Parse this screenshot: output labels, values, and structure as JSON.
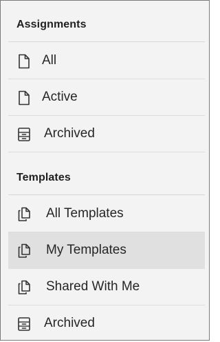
{
  "sections": [
    {
      "title": "Assignments",
      "items": [
        {
          "label": "All",
          "icon": "file-icon"
        },
        {
          "label": "Active",
          "icon": "file-icon"
        },
        {
          "label": "Archived",
          "icon": "archive-icon"
        }
      ]
    },
    {
      "title": "Templates",
      "items": [
        {
          "label": "All Templates",
          "icon": "copy-icon"
        },
        {
          "label": "My Templates",
          "icon": "copy-icon",
          "selected": true
        },
        {
          "label": "Shared With Me",
          "icon": "copy-icon"
        },
        {
          "label": "Archived",
          "icon": "archive-icon"
        }
      ]
    }
  ],
  "colors": {
    "background": "#f3f3f3",
    "selected": "#e0e0e0",
    "text": "#262626",
    "icon": "#333333"
  }
}
